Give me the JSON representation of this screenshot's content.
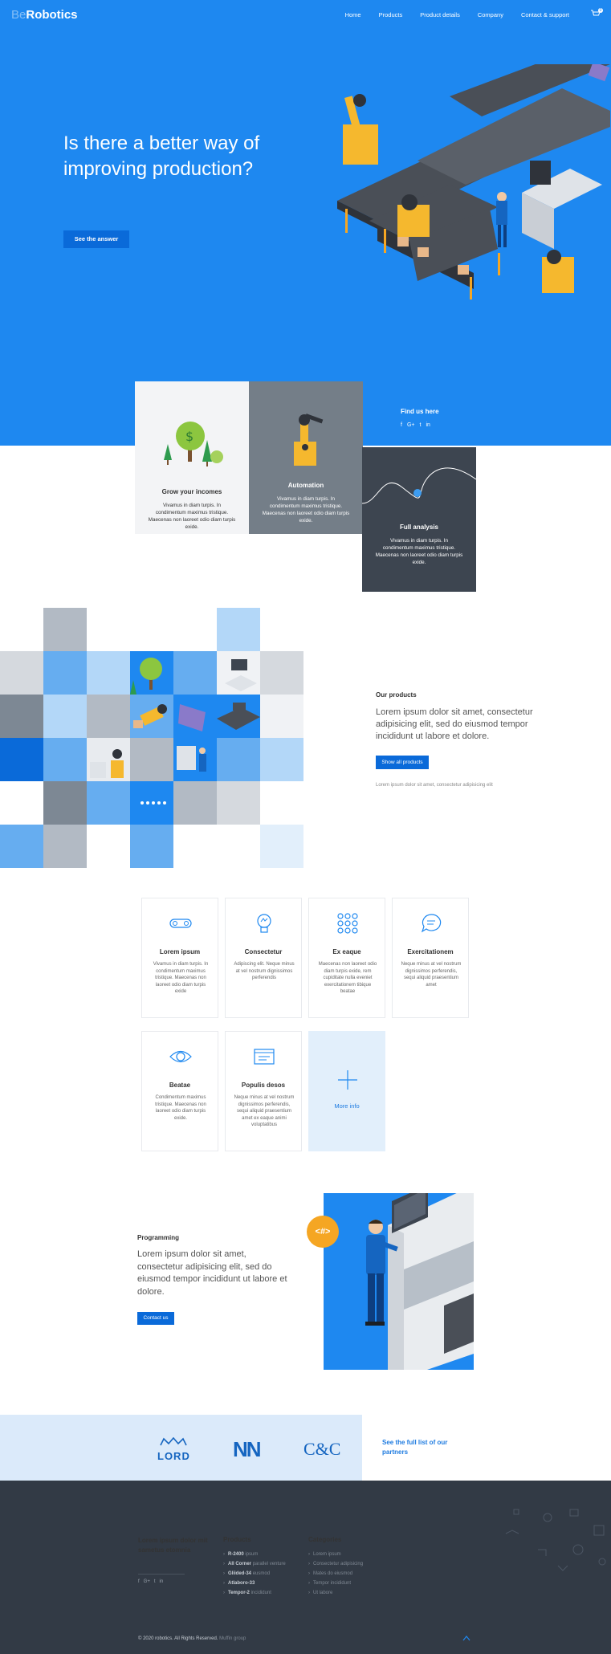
{
  "header": {
    "logo_prefix": "Be",
    "logo_name": "Robotics",
    "nav": [
      "Home",
      "Products",
      "Product details",
      "Company",
      "Contact & support"
    ],
    "cart_count": "0"
  },
  "hero": {
    "title": "Is there a better way of improving production?",
    "button": "See the answer"
  },
  "features": [
    {
      "title": "Grow your incomes",
      "text": "Vivamus in diam turpis. In condimentum maximus tristique. Maecenas non laoreet odio diam turpis exide."
    },
    {
      "title": "Automation",
      "text": "Vivamus in diam turpis. In condimentum maximus tristique. Maecenas non laoreet odio diam turpis exide."
    },
    {
      "title": "Full analysis",
      "text": "Vivamus in diam turpis. In condimentum maximus tristique. Maecenas non laoreet odio diam turpis exide."
    }
  ],
  "findus": {
    "title": "Find us here",
    "socials": [
      "f",
      "G+",
      "t",
      "in"
    ]
  },
  "products": {
    "label": "Our products",
    "lead": "Lorem ipsum dolor sit amet, consectetur adipisicing elit, sed do eiusmod tempor incididunt ut labore et dolore.",
    "button": "Show all products",
    "small": "Lorem ipsum dolor sit amet, consectetur adipisicing elit"
  },
  "services": [
    {
      "title": "Lorem ipsum",
      "text": "Vivamus in diam turpis. In condimentum maximus tristique. Maecenas non laoreet odio diam turpis exide",
      "icon": "conveyor-icon"
    },
    {
      "title": "Consectetur",
      "text": "Adipiscing elit. Neque minus at vel nostrum dignissimos perferendis",
      "icon": "lightbulb-icon"
    },
    {
      "title": "Ex eaque",
      "text": "Maecenas non laoreet odio diam turpis exide, rem cupiditate nulla eveniet exercitationem tibique beatae",
      "icon": "grid-dots-icon"
    },
    {
      "title": "Exercitationem",
      "text": "Neque minus at vel nostrum dignissimos perferendis, sequi aliquid praesentium amet",
      "icon": "chat-bubble-icon"
    },
    {
      "title": "Beatae",
      "text": "Condimentum maximus tristique. Maecenas non laoreet odio diam turpis exide.",
      "icon": "eye-icon"
    },
    {
      "title": "Populis desos",
      "text": "Neque minus at vel nostrum dignissimos perferendis, sequi aliquid praesentium amet ex eaque animi voluptatibus",
      "icon": "window-icon"
    }
  ],
  "more": {
    "label": "More info"
  },
  "programming": {
    "label": "Programming",
    "lead": "Lorem ipsum dolor sit amet, consectetur adipisicing elit, sed do eiusmod tempor incididunt ut labore et dolore.",
    "button": "Contact us",
    "badge": "<#>"
  },
  "partners": {
    "logos": [
      "LORD",
      "NN",
      "C&C"
    ],
    "link": "See the full list of our partners"
  },
  "footer": {
    "about": "Lorem ipsum dolor mit sametus etomnia",
    "socials": [
      "f",
      "G+",
      "t",
      "in"
    ],
    "products_title": "Products",
    "products": [
      {
        "name": "R-2400",
        "desc": "ipsum"
      },
      {
        "name": "All Corner",
        "desc": "parallel venture"
      },
      {
        "name": "Gliided-34",
        "desc": "eusmod"
      },
      {
        "name": "Atlaboro-33",
        "desc": ""
      },
      {
        "name": "Tempor-2",
        "desc": "incididunt"
      }
    ],
    "categories_title": "Categories",
    "categories": [
      "Lorem ipsum",
      "Consectetur adipisicing",
      "Mates do eiusmod",
      "Tempor incididunt",
      "Ut labore"
    ],
    "copyright": "© 2020 robotics. All Rights Reserved.",
    "credit": "Muffin group"
  },
  "colors": {
    "brand_blue": "#1e88f0",
    "button_blue": "#0a6ad9",
    "footer_bg": "#323a45",
    "light_blue": "#dbeafa"
  }
}
